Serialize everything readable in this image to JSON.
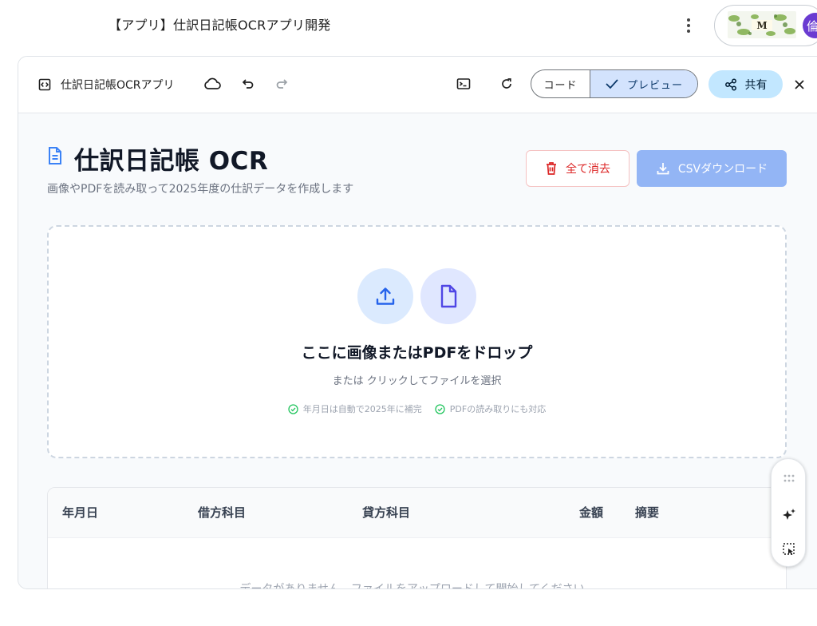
{
  "window": {
    "title": "【アプリ】仕訳日記帳OCRアプリ開発",
    "avatar_initial": "倫"
  },
  "toolbar": {
    "app_name": "仕訳日記帳OCRアプリ",
    "code_label": "コード",
    "preview_label": "プレビュー",
    "share_label": "共有"
  },
  "page": {
    "title": "仕訳日記帳 OCR",
    "subtitle": "画像やPDFを読み取って2025年度の仕訳データを作成します",
    "clear_button": "全て消去",
    "csv_button": "CSVダウンロード"
  },
  "dropzone": {
    "title": "ここに画像またはPDFをドロップ",
    "subtitle": "または クリックしてファイルを選択",
    "notes": [
      "年月日は自動で2025年に補完",
      "PDFの読み取りにも対応"
    ]
  },
  "table": {
    "headers": [
      "年月日",
      "借方科目",
      "貸方科目",
      "金額",
      "摘要"
    ],
    "empty_message": "データがありません。ファイルをアップロードして開始してください。"
  },
  "colors": {
    "accent": "#3b82f6",
    "danger": "#dc2626",
    "csv_button_bg": "#93b5f5",
    "preview_selected_bg": "#d3e3fd",
    "share_bg": "#c2e7ff",
    "success_icon": "#22c55e"
  },
  "icons": [
    "code-bracket-icon",
    "cloud-icon",
    "undo-icon",
    "redo-icon",
    "terminal-icon",
    "refresh-icon",
    "check-icon",
    "share-icon",
    "close-icon",
    "document-icon",
    "trash-icon",
    "download-icon",
    "upload-icon",
    "file-icon",
    "check-circle-icon",
    "drag-handle-icon",
    "sparkle-icon",
    "select-element-icon",
    "more-vert-icon"
  ]
}
